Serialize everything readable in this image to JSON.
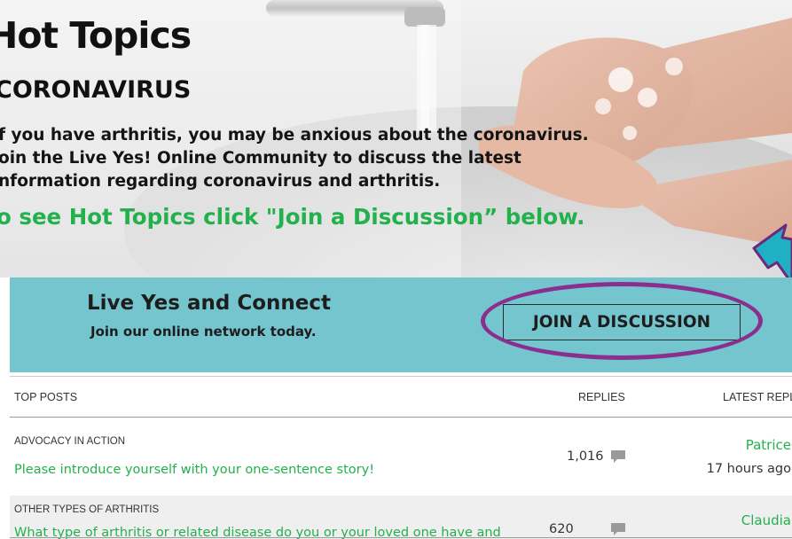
{
  "hero": {
    "title": "Hot Topics",
    "subtitle": "CORONAVIRUS",
    "body_lines": [
      "f you have arthritis, you may be anxious about the coronavirus.",
      "oin the Live Yes! Online Community to discuss the latest",
      "nformation regarding coronavirus and arthritis."
    ],
    "cta": "o see Hot Topics click \"Join a Discussion” below."
  },
  "connect": {
    "title": "Live Yes and Connect",
    "subtitle": "Join our online network today.",
    "join_button": "JOIN A DISCUSSION",
    "banner_color": "#75c5cf",
    "annotation_color": "#8b2f8f",
    "arrow_color": "#1fb1c3"
  },
  "table": {
    "headers": {
      "top_posts": "TOP POSTS",
      "replies": "REPLIES",
      "latest_reply": "LATEST REPLY"
    },
    "rows": [
      {
        "category": "ADVOCACY IN ACTION",
        "topic": "Please introduce yourself with your one-sentence story!",
        "replies": "1,016",
        "latest_user": "Patrice",
        "latest_time": "17 hours ago"
      },
      {
        "category": "OTHER TYPES OF ARTHRITIS",
        "topic": "What type of arthritis or related disease do you or your loved one have and",
        "replies": "620",
        "latest_user": "Claudia",
        "latest_time": ""
      }
    ]
  },
  "colors": {
    "accent_green": "#22b14c",
    "text_dark": "#1d1d1d"
  },
  "icons": {
    "reply_icon": "comment-bubble-icon",
    "annotation_arrow": "arrow-pointer-icon"
  }
}
